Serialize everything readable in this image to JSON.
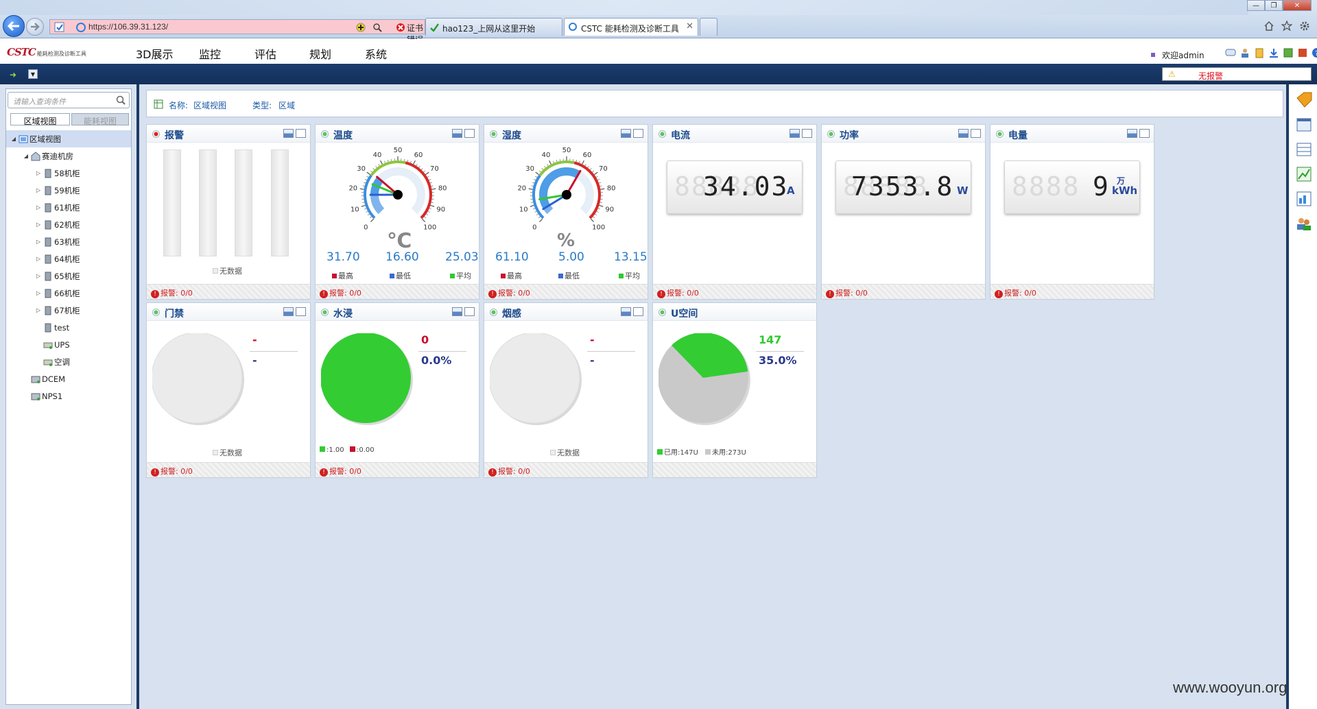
{
  "browser": {
    "address_url": "https://106.39.31.123/",
    "cert_error": "证书错误",
    "tabs": [
      {
        "label": "hao123_上网从这里开始"
      },
      {
        "label": "CSTC 能耗检测及诊断工具"
      }
    ]
  },
  "header": {
    "logo": "CSTC",
    "logo_sub": "能耗检测及诊断工具",
    "menu": [
      "3D展示",
      "监控",
      "评估",
      "规划",
      "系统"
    ],
    "welcome": "欢迎admin"
  },
  "toolbar": {
    "alarm_text": "无报警"
  },
  "sidebar": {
    "search_placeholder": "请输入查询条件",
    "tabs": [
      "区域视图",
      "能耗视图"
    ],
    "tree": [
      {
        "label": "区域视图",
        "level": 0,
        "expanded": true,
        "selected": true,
        "icon": "area-icon"
      },
      {
        "label": "赛迪机房",
        "level": 1,
        "expanded": true,
        "icon": "room-icon"
      },
      {
        "label": "58机柜",
        "level": 2,
        "icon": "cabinet-icon"
      },
      {
        "label": "59机柜",
        "level": 2,
        "icon": "cabinet-icon"
      },
      {
        "label": "61机柜",
        "level": 2,
        "icon": "cabinet-icon"
      },
      {
        "label": "62机柜",
        "level": 2,
        "icon": "cabinet-icon"
      },
      {
        "label": "63机柜",
        "level": 2,
        "icon": "cabinet-icon"
      },
      {
        "label": "64机柜",
        "level": 2,
        "icon": "cabinet-icon"
      },
      {
        "label": "65机柜",
        "level": 2,
        "icon": "cabinet-icon"
      },
      {
        "label": "66机柜",
        "level": 2,
        "icon": "cabinet-icon"
      },
      {
        "label": "67机柜",
        "level": 2,
        "icon": "cabinet-icon"
      },
      {
        "label": "test",
        "level": 2,
        "leaf": true,
        "icon": "cabinet-icon"
      },
      {
        "label": "UPS",
        "level": 2,
        "leaf": true,
        "icon": "ups-icon"
      },
      {
        "label": "空调",
        "level": 2,
        "leaf": true,
        "icon": "aircon-icon"
      },
      {
        "label": "DCEM",
        "level": 1,
        "leaf": true,
        "icon": "device-icon"
      },
      {
        "label": "NPS1",
        "level": 1,
        "leaf": true,
        "icon": "device-icon"
      }
    ]
  },
  "info": {
    "name_label": "名称:",
    "name_value": "区域视图",
    "type_label": "类型:",
    "type_value": "区域"
  },
  "panels": {
    "alarm": {
      "title": "报警",
      "nodata": "无数据",
      "footer": "报警: 0/0"
    },
    "temp": {
      "title": "温度",
      "unit": "℃",
      "max": "31.70",
      "min": "16.60",
      "avg": "25.03",
      "legend": [
        "最高",
        "最低",
        "平均"
      ],
      "footer": "报警: 0/0"
    },
    "humid": {
      "title": "湿度",
      "unit": "%",
      "max": "61.10",
      "min": "5.00",
      "avg": "13.15",
      "legend": [
        "最高",
        "最低",
        "平均"
      ],
      "footer": "报警: 0/0"
    },
    "current": {
      "title": "电流",
      "ghost": "88888",
      "value": "34.03",
      "unit": "A",
      "footer": "报警: 0/0"
    },
    "power": {
      "title": "功率",
      "ghost": "88888",
      "value": "7353.8",
      "unit": "W",
      "footer": "报警: 0/0"
    },
    "energy": {
      "title": "电量",
      "ghost": "8888",
      "value": "9",
      "unit_top": "万",
      "unit": "kWh",
      "footer": "报警: 0/0"
    },
    "door": {
      "title": "门禁",
      "v1": "-",
      "v2": "-",
      "nodata": "无数据",
      "footer": "报警: 0/0"
    },
    "water": {
      "title": "水浸",
      "v1": "0",
      "v2": "0.0%",
      "leg1": ":1.00",
      "leg2": ":0.00",
      "footer": "报警: 0/0"
    },
    "smoke": {
      "title": "烟感",
      "v1": "-",
      "v2": "-",
      "nodata": "无数据",
      "footer": "报警: 0/0"
    },
    "uspace": {
      "title": "U空间",
      "used": "147",
      "pct": "35.0%",
      "used_frac": 0.35,
      "leg1": "已用:147U",
      "leg2": "未用:273U"
    }
  },
  "gauge_ticks": [
    "0",
    "10",
    "20",
    "30",
    "40",
    "50",
    "60",
    "70",
    "80",
    "90",
    "100"
  ],
  "colors": {
    "accent": "#1d4b8c",
    "green": "#2fc92f",
    "red": "#c8102e",
    "gauge_blue": "#3b8fe0"
  },
  "watermark": "www.wooyun.org"
}
